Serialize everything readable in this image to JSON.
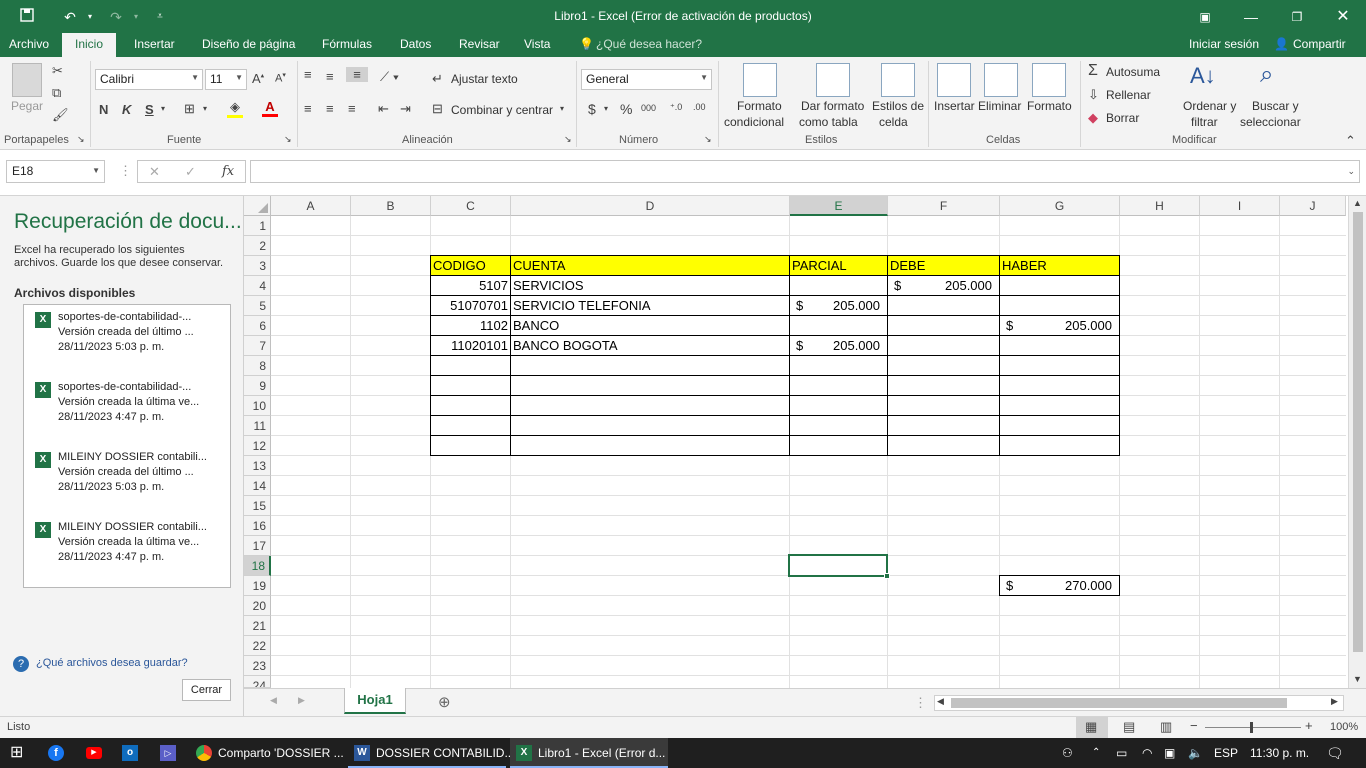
{
  "title": "Libro1 - Excel (Error de activación de productos)",
  "ribbon_tabs": [
    "Archivo",
    "Inicio",
    "Insertar",
    "Diseño de página",
    "Fórmulas",
    "Datos",
    "Revisar",
    "Vista"
  ],
  "tell_me": "¿Qué desea hacer?",
  "signin": "Iniciar sesión",
  "share": "Compartir",
  "clipboard": {
    "paste": "Pegar",
    "group": "Portapapeles"
  },
  "font": {
    "name": "Calibri",
    "size": "11",
    "bold": "N",
    "italic": "K",
    "underline": "S",
    "group": "Fuente"
  },
  "alignment": {
    "wrap": "Ajustar texto",
    "merge": "Combinar y centrar",
    "group": "Alineación"
  },
  "number": {
    "format": "General",
    "currency": "$",
    "percent": "%",
    "thousands": "000",
    "group": "Número"
  },
  "styles": {
    "cond1": "Formato",
    "cond2": "condicional",
    "table1": "Dar formato",
    "table2": "como tabla",
    "cell1": "Estilos de",
    "cell2": "celda",
    "group": "Estilos"
  },
  "cells": {
    "insert": "Insertar",
    "delete": "Eliminar",
    "format": "Formato",
    "group": "Celdas"
  },
  "editing": {
    "autosum": "Autosuma",
    "fill": "Rellenar",
    "clear": "Borrar",
    "sort1": "Ordenar y",
    "sort2": "filtrar",
    "find1": "Buscar y",
    "find2": "seleccionar",
    "group": "Modificar"
  },
  "namebox": "E18",
  "fx": "fx",
  "recovery": {
    "title": "Recuperación de docu...",
    "desc1": "Excel ha recuperado los siguientes",
    "desc2": "archivos. Guarde los que desee conservar.",
    "available": "Archivos disponibles",
    "files": [
      {
        "name": "soportes-de-contabilidad-...",
        "version": "Versión creada del último ...",
        "date": "28/11/2023 5:03 p. m."
      },
      {
        "name": "soportes-de-contabilidad-...",
        "version": "Versión creada la última ve...",
        "date": "28/11/2023 4:47 p. m."
      },
      {
        "name": "MILEINY DOSSIER contabili...",
        "version": "Versión creada del último ...",
        "date": "28/11/2023 5:03 p. m."
      },
      {
        "name": "MILEINY DOSSIER contabili...",
        "version": "Versión creada la última ve...",
        "date": "28/11/2023 4:47 p. m."
      }
    ],
    "question": "¿Qué archivos desea guardar?",
    "close": "Cerrar"
  },
  "columns": [
    "A",
    "B",
    "C",
    "D",
    "E",
    "F",
    "G",
    "H",
    "I",
    "J"
  ],
  "rows": [
    "1",
    "2",
    "3",
    "4",
    "5",
    "6",
    "7",
    "8",
    "9",
    "10",
    "11",
    "12",
    "13",
    "14",
    "15",
    "16",
    "17",
    "18",
    "19",
    "20",
    "21",
    "22",
    "23",
    "24"
  ],
  "sheet": {
    "headers": {
      "codigo": "CODIGO",
      "cuenta": "CUENTA",
      "parcial": "PARCIAL",
      "debe": "DEBE",
      "haber": "HABER"
    },
    "r4": {
      "codigo": "5107",
      "cuenta": "SERVICIOS",
      "debe_sym": "$",
      "debe": "205.000"
    },
    "r5": {
      "codigo": "51070701",
      "cuenta": "SERVICIO TELEFONIA",
      "parcial_sym": "$",
      "parcial": "205.000"
    },
    "r6": {
      "codigo": "1102",
      "cuenta": "BANCO",
      "haber_sym": "$",
      "haber": "205.000"
    },
    "r7": {
      "codigo": "11020101",
      "cuenta": "BANCO BOGOTA",
      "parcial_sym": "$",
      "parcial": "205.000"
    },
    "r19": {
      "haber_sym": "$",
      "haber": "270.000"
    }
  },
  "sheet_tab": "Hoja1",
  "status": "Listo",
  "zoom": "100%",
  "taskbar": {
    "apps": [
      "Comparto 'DOSSIER ...",
      "DOSSIER CONTABILID...",
      "Libro1 - Excel (Error d..."
    ],
    "lang": "ESP",
    "time": "11:30 p. m."
  },
  "colors": {
    "excel_green": "#217346",
    "header_yellow": "#ffff00"
  }
}
